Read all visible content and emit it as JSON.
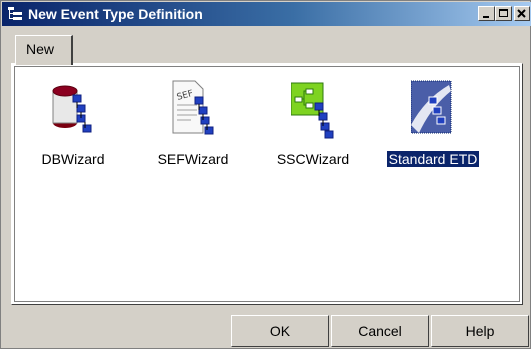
{
  "window": {
    "title": "New Event Type Definition",
    "icon": "tree-icon",
    "controls": {
      "minimize": "minimize-icon",
      "maximize": "maximize-icon",
      "close": "close-icon"
    }
  },
  "tabs": [
    {
      "label": "New",
      "selected": true
    }
  ],
  "items": [
    {
      "label": "DBWizard",
      "icon": "database-wizard-icon",
      "selected": false
    },
    {
      "label": "SEFWizard",
      "icon": "sef-wizard-icon",
      "selected": false
    },
    {
      "label": "SSCWizard",
      "icon": "ssc-wizard-icon",
      "selected": false
    },
    {
      "label": "Standard ETD",
      "icon": "standard-etd-icon",
      "selected": true
    }
  ],
  "buttons": {
    "ok": "OK",
    "cancel": "Cancel",
    "help": "Help"
  },
  "colors": {
    "titlebar": "#0a246a",
    "face": "#d4d0c8",
    "selection": "#0a246a"
  }
}
